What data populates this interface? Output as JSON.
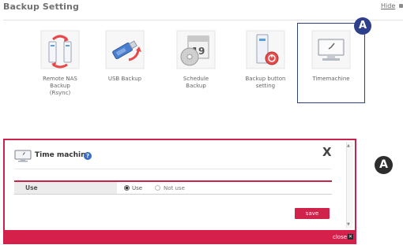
{
  "header": {
    "title": "Backup Setting",
    "hide_label": "Hide"
  },
  "tiles": [
    {
      "label": "Remote NAS\nBackup\n(Rsync)",
      "icon": "remote-nas-sync-icon"
    },
    {
      "label": "USB Backup",
      "icon": "usb-backup-icon"
    },
    {
      "label": "Schedule\nBackup",
      "icon": "schedule-backup-icon"
    },
    {
      "label": "Backup button\nsetting",
      "icon": "backup-button-icon"
    },
    {
      "label": "Timemachine",
      "icon": "monitor-clock-icon"
    }
  ],
  "callouts": {
    "badge_top": "A",
    "badge_right": "A"
  },
  "dialog": {
    "title": "Time machine",
    "close_label": "X",
    "help_glyph": "?",
    "use_row": {
      "label": "Use",
      "options": [
        "Use",
        "Not use"
      ],
      "selected": "Use"
    },
    "save_label": "save",
    "footer_close_label": "close"
  },
  "colors": {
    "accent": "#d0234c",
    "selection": "#2e3f8c",
    "badge": "#2d2d2d"
  }
}
